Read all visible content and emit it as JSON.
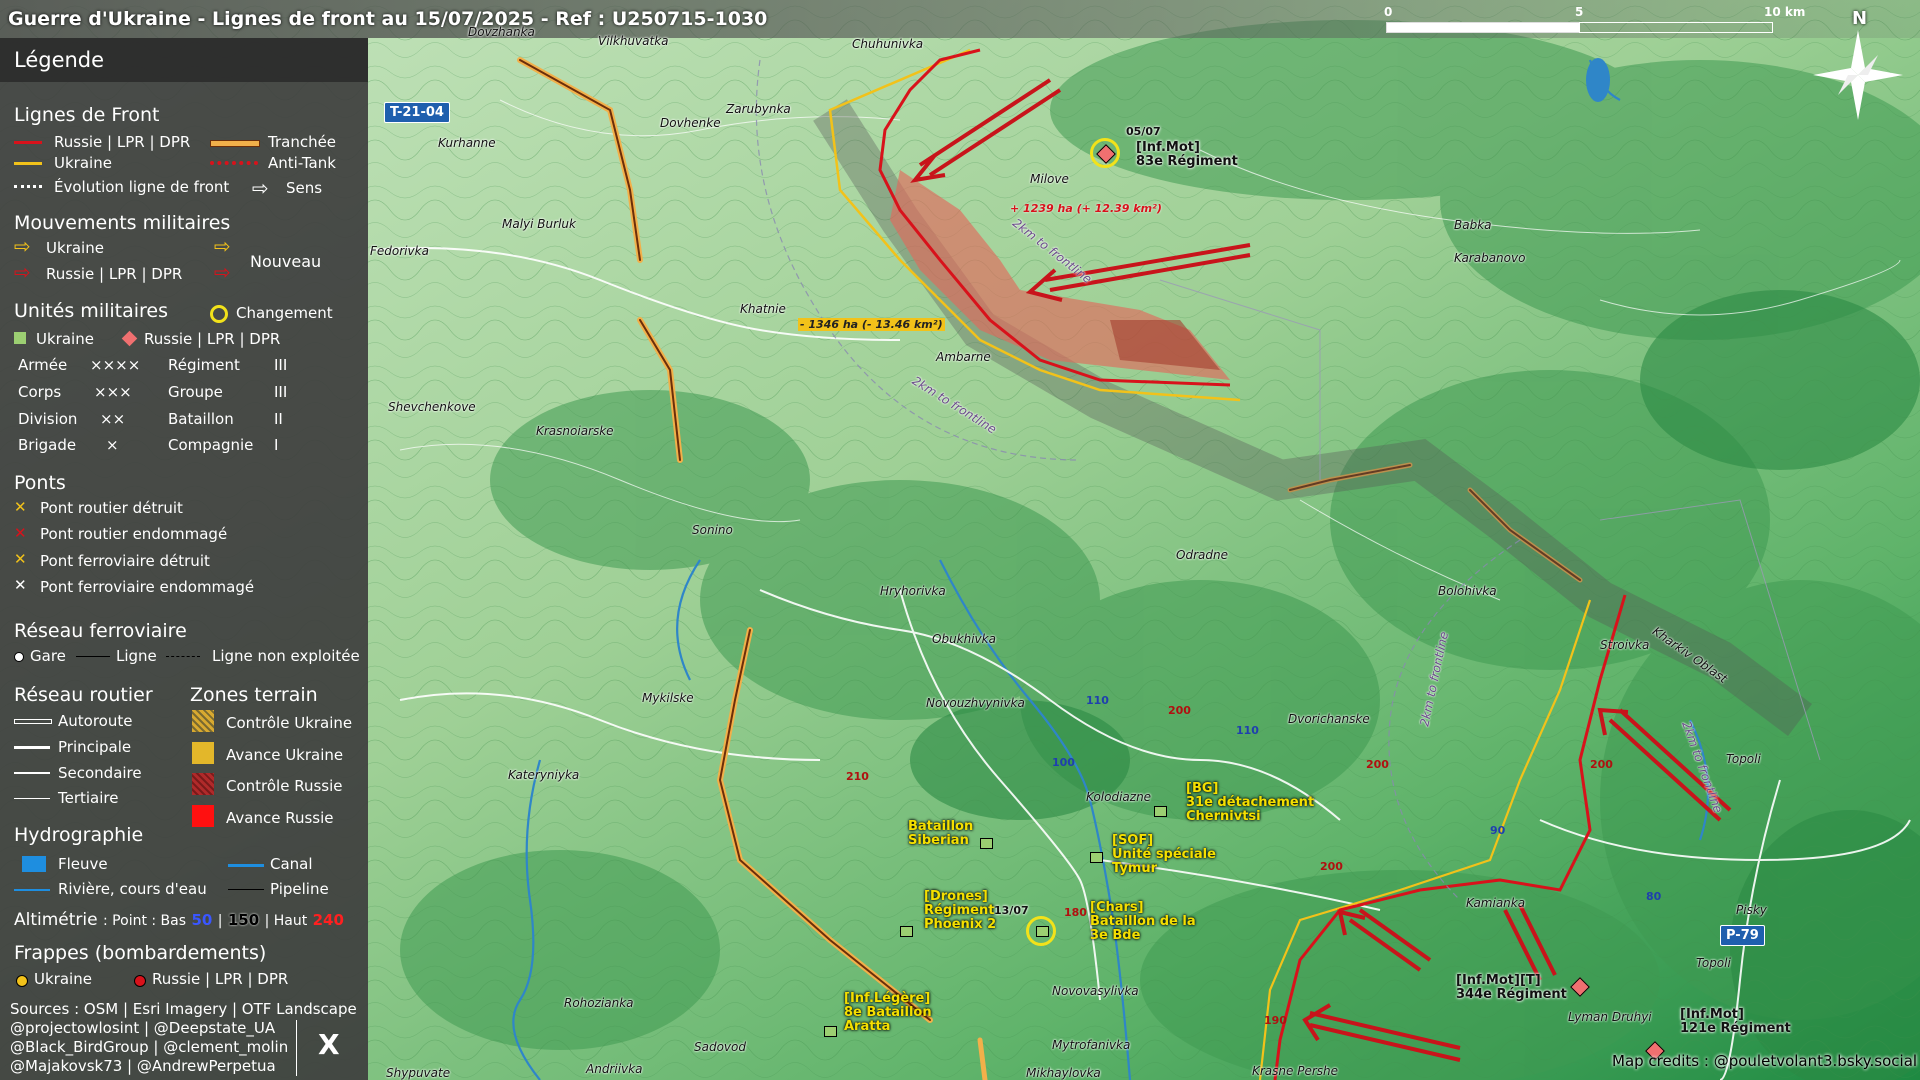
{
  "header": {
    "title": "Guerre d'Ukraine - Lignes de front au 15/07/2025 - Ref : U250715-1030"
  },
  "scale": {
    "labels": [
      "0",
      "5",
      "10 km"
    ]
  },
  "compass": {
    "label": "N"
  },
  "legend": {
    "title": "Légende",
    "front": {
      "title": "Lignes de Front",
      "russia": "Russie | LPR | DPR",
      "ukraine": "Ukraine",
      "trench": "Tranchée",
      "antitank": "Anti-Tank",
      "evolution": "Évolution ligne de front",
      "direction": "Sens"
    },
    "movements": {
      "title": "Mouvements militaires",
      "ukraine": "Ukraine",
      "russia": "Russie | LPR | DPR",
      "new": "Nouveau"
    },
    "units": {
      "title": "Unités militaires",
      "change": "Changement",
      "ukraine": "Ukraine",
      "russia": "Russie | LPR | DPR",
      "table": [
        {
          "name": "Armée",
          "sym": "××××",
          "name2": "Régiment",
          "sym2": "III"
        },
        {
          "name": "Corps",
          "sym": "×××",
          "name2": "Groupe",
          "sym2": "III"
        },
        {
          "name": "Division",
          "sym": "××",
          "name2": "Bataillon",
          "sym2": "II"
        },
        {
          "name": "Brigade",
          "sym": "×",
          "name2": "Compagnie",
          "sym2": "I"
        }
      ]
    },
    "bridges": {
      "title": "Ponts",
      "items": [
        "Pont routier détruit",
        "Pont routier endommagé",
        "Pont ferroviaire détruit",
        "Pont ferroviaire endommagé"
      ]
    },
    "rail": {
      "title": "Réseau ferroviaire",
      "station": "Gare",
      "line": "Ligne",
      "unused": "Ligne non exploitée"
    },
    "roads": {
      "title": "Réseau routier",
      "items": [
        "Autoroute",
        "Principale",
        "Secondaire",
        "Tertiaire"
      ]
    },
    "zones": {
      "title": "Zones terrain",
      "items": [
        "Contrôle Ukraine",
        "Avance Ukraine",
        "Contrôle Russie",
        "Avance Russie"
      ]
    },
    "hydro": {
      "title": "Hydrographie",
      "river_big": "Fleuve",
      "canal": "Canal",
      "river": "Rivière, cours d'eau",
      "pipeline": "Pipeline"
    },
    "altimetry": {
      "title": "Altimétrie",
      "text": ": Point : Bas",
      "low": "50",
      "sep1": "|",
      "mid": "150",
      "sep2": "| Haut",
      "high": "240"
    },
    "strikes": {
      "title": "Frappes (bombardements)",
      "ukraine": "Ukraine",
      "russia": "Russie | LPR | DPR"
    },
    "sources": [
      "Sources : OSM | Esri Imagery | OTF Landscape",
      "@projectowlosint | @Deepstate_UA",
      "@Black_BirdGroup | @clement_molin",
      "@Majakovsk73 | @AndrewPerpetua"
    ],
    "x_icon": "X"
  },
  "map": {
    "places": [
      {
        "name": "Dovzhanka"
      },
      {
        "name": "Vilkhuvatka"
      },
      {
        "name": "Chuhunivka"
      },
      {
        "name": "Zarubynka"
      },
      {
        "name": "Dovhenke"
      },
      {
        "name": "Kurhanne"
      },
      {
        "name": "Malyi Burluk"
      },
      {
        "name": "Fedorivka"
      },
      {
        "name": "Milove"
      },
      {
        "name": "Khatnie"
      },
      {
        "name": "Ambarne"
      },
      {
        "name": "Shevchenkove"
      },
      {
        "name": "Krasnoiarske"
      },
      {
        "name": "Babka"
      },
      {
        "name": "Karabanovo"
      },
      {
        "name": "Sonino"
      },
      {
        "name": "Odradne"
      },
      {
        "name": "Bolohivka"
      },
      {
        "name": "Hryhorivka"
      },
      {
        "name": "Obukhivka"
      },
      {
        "name": "Stroivka"
      },
      {
        "name": "Novouzhvynivka"
      },
      {
        "name": "Mykilske"
      },
      {
        "name": "Dvorichanske"
      },
      {
        "name": "Kateryniyka"
      },
      {
        "name": "Kolodiazne"
      },
      {
        "name": "Topoli"
      },
      {
        "name": "Kamianka"
      },
      {
        "name": "Pisky"
      },
      {
        "name": "Rohozianka"
      },
      {
        "name": "Novovasylivka"
      },
      {
        "name": "Sadovod"
      },
      {
        "name": "Mytrofanivka"
      },
      {
        "name": "Lyman Druhyi"
      },
      {
        "name": "Shypuvate"
      },
      {
        "name": "Andriivka"
      },
      {
        "name": "Mikhaylovka"
      },
      {
        "name": "Krasne Pershe"
      },
      {
        "name": "Topoli"
      },
      {
        "name": "Kharkiv Oblast"
      }
    ],
    "road_shields": [
      {
        "label": "T-21-04"
      },
      {
        "label": "P-79"
      }
    ],
    "road_numbers": [
      {
        "label": "110"
      },
      {
        "label": "200"
      },
      {
        "label": "110"
      },
      {
        "label": "100"
      },
      {
        "label": "210"
      },
      {
        "label": "200"
      },
      {
        "label": "200"
      },
      {
        "label": "90"
      },
      {
        "label": "200"
      },
      {
        "label": "80"
      },
      {
        "label": "180"
      },
      {
        "label": "190"
      }
    ],
    "frontline_labels": [
      "2km to frontline",
      "2km to frontline",
      "2km to frontline",
      "2km to frontline"
    ],
    "gain_ru": "+ 1239 ha (+ 12.39 km²)",
    "loss_ua": "- 1346 ha (- 13.46 km²)",
    "units": [
      {
        "date": "05/07",
        "label": "[Inf.Mot]\n83e Régiment",
        "side": "ru"
      },
      {
        "label": "[BG]\n31e détachement\nChernivtsi",
        "side": "ua"
      },
      {
        "label": "Bataillon\nSiberian",
        "side": "ua"
      },
      {
        "label": "[SOF]\nUnité spéciale\nTymur",
        "side": "ua"
      },
      {
        "label": "[Drones]\nRégiment\nPhoenix 2",
        "side": "ua"
      },
      {
        "date": "13/07",
        "label": "[Chars]\nBataillon de la\n3e Bde",
        "side": "ua"
      },
      {
        "label": "[Inf.Légère]\n8e Bataillon\nAratta",
        "side": "ua"
      },
      {
        "label": "[Inf.Mot][T]\n344e Régiment",
        "side": "ru"
      },
      {
        "label": "[Inf.Mot]\n121e Régiment",
        "side": "ru"
      }
    ],
    "credits": "Map credits : @pouletvolant3.bsky.social"
  },
  "colors": {
    "russia": "#d8121b",
    "ukraine": "#f2c21a",
    "ru_zone": "#e07b67",
    "terrain_low": "#c8e6c0",
    "terrain_high": "#1f8a3f"
  }
}
